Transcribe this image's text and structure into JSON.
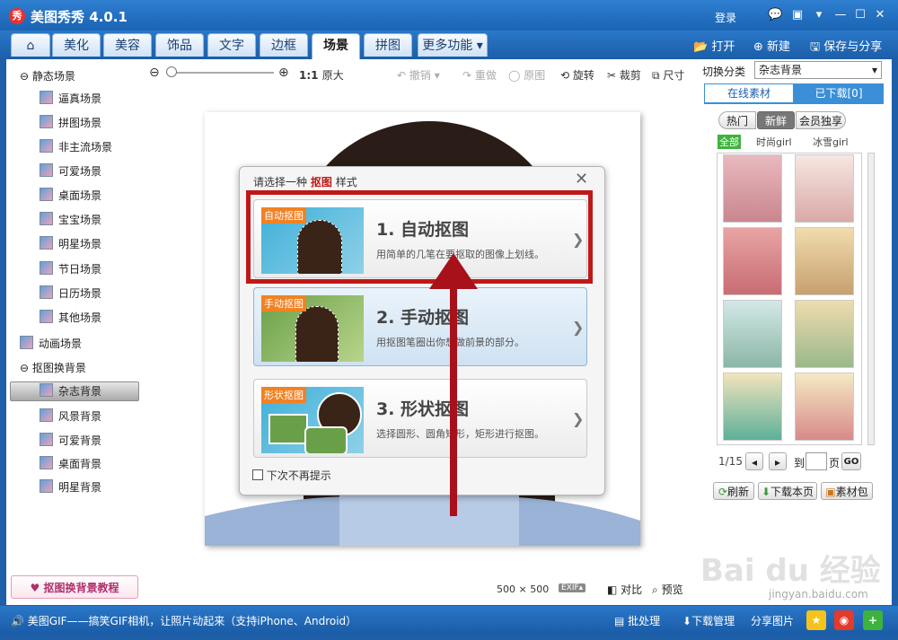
{
  "app": {
    "title": "美图秀秀 4.0.1",
    "logo": "秀",
    "login": "登录"
  },
  "window_controls": {
    "feedback": "💬",
    "skin": "▣",
    "menu": "▾",
    "minimize": "—",
    "maximize": "☐",
    "close": "✕"
  },
  "tabs": [
    {
      "label": "⌂",
      "active": false
    },
    {
      "label": "美化",
      "active": false
    },
    {
      "label": "美容",
      "active": false
    },
    {
      "label": "饰品",
      "active": false
    },
    {
      "label": "文字",
      "active": false
    },
    {
      "label": "边框",
      "active": false
    },
    {
      "label": "场景",
      "active": true
    },
    {
      "label": "拼图",
      "active": false
    },
    {
      "label": "更多功能 ▾",
      "active": false
    }
  ],
  "top_actions": {
    "open": "打开",
    "new": "新建",
    "save_share": "保存与分享"
  },
  "sidebar": {
    "group1": "静态场景",
    "group1_items": [
      "逼真场景",
      "拼图场景",
      "非主流场景",
      "可爱场景",
      "桌面场景",
      "宝宝场景",
      "明星场景",
      "节日场景",
      "日历场景",
      "其他场景"
    ],
    "group2": "动画场景",
    "group3": "抠图换背景",
    "group3_items": [
      "杂志背景",
      "风景背景",
      "可爱背景",
      "桌面背景",
      "明星背景"
    ],
    "selected": "杂志背景",
    "tutorial": "抠图换背景教程"
  },
  "toolbar": {
    "zoom_ratio": "1:1",
    "original_size": "原大",
    "undo": "撤销",
    "redo": "重做",
    "original": "原图",
    "rotate": "旋转",
    "crop": "裁剪",
    "size": "尺寸",
    "switch_category_label": "切换分类",
    "category_value": "杂志背景"
  },
  "dialog": {
    "title_prefix": "请选择一种",
    "title_highlight": "抠图",
    "title_suffix": "样式",
    "options": [
      {
        "tag": "自动抠图",
        "title": "1. 自动抠图",
        "desc": "用简单的几笔在要抠取的图像上划线。"
      },
      {
        "tag": "手动抠图",
        "title": "2. 手动抠图",
        "desc": "用抠图笔圈出你想做前景的部分。"
      },
      {
        "tag": "形状抠图",
        "title": "3. 形状抠图",
        "desc": "选择圆形、圆角矩形，矩形进行抠图。"
      }
    ],
    "dont_show": "下次不再提示"
  },
  "canvas_info": {
    "width": "500",
    "times": "×",
    "height": "500",
    "exif": "EXIF▴",
    "compare": "对比",
    "preview": "预览"
  },
  "right_panel": {
    "tab_online": "在线素材",
    "tab_downloaded": "已下载[0]",
    "filters": [
      "热门",
      "新鲜",
      "会员独享"
    ],
    "active_filter": "新鲜",
    "subfilters": [
      "全部",
      "时尚girl",
      "冰雪girl"
    ],
    "page_info": "1/15",
    "goto_label": "到",
    "page_label": "页",
    "go": "GO",
    "refresh": "刷新",
    "download_page": "下载本页",
    "material_pack": "素材包"
  },
  "status": {
    "marquee": "美图GIF——搞笑GIF相机，让照片动起来（支持iPhone、Android）",
    "batch": "批处理",
    "download_mgr": "下载管理",
    "share_img": "分享图片"
  },
  "watermark": "Bai du 经验",
  "watermark_url": "jingyan.baidu.com",
  "colors": {
    "highlight_box": "#c01818",
    "arrow": "#a8101a",
    "title_bar": "#1f68b6",
    "orange_tag": "#f28122",
    "green_filter": "#3db33d"
  }
}
